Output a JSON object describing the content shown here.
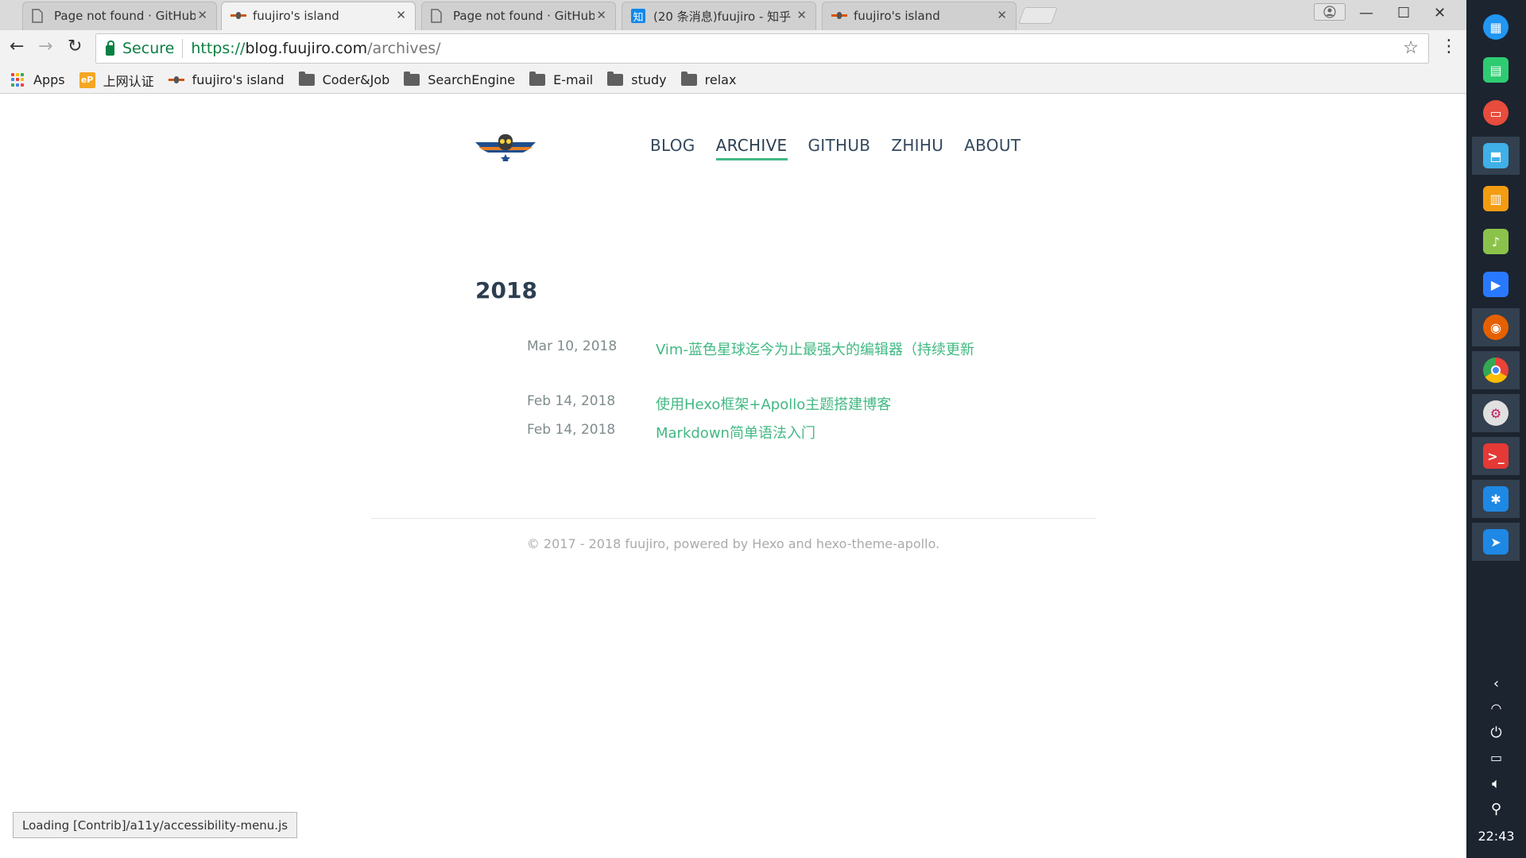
{
  "browser": {
    "tabs": [
      {
        "title": "Page not found · GitHub",
        "icon": "page-icon",
        "active": false
      },
      {
        "title": "fuujiro's island",
        "icon": "plane-icon",
        "active": true
      },
      {
        "title": "Page not found · GitHub",
        "icon": "page-icon",
        "active": false
      },
      {
        "title": "(20 条消息)fuujiro - 知乎",
        "icon": "zhihu-icon",
        "active": false
      },
      {
        "title": "fuujiro's island",
        "icon": "plane-icon",
        "active": false
      }
    ],
    "zhihu_glyph": "知",
    "secure_label": "Secure",
    "url_scheme": "https://",
    "url_host": "blog.fuujiro.com",
    "url_path": "/archives/",
    "bookmarks": [
      {
        "label": "Apps",
        "icon": "apps-grid-icon"
      },
      {
        "label": "上网认证",
        "icon": "ep-icon"
      },
      {
        "label": "fuujiro's island",
        "icon": "plane-icon"
      },
      {
        "label": "Coder&Job",
        "icon": "folder-icon"
      },
      {
        "label": "SearchEngine",
        "icon": "folder-icon"
      },
      {
        "label": "E-mail",
        "icon": "folder-icon"
      },
      {
        "label": "study",
        "icon": "folder-icon"
      },
      {
        "label": "relax",
        "icon": "folder-icon"
      }
    ],
    "ep_glyph": "eP",
    "status": "Loading [Contrib]/a11y/accessibility-menu.js"
  },
  "site": {
    "nav": [
      {
        "label": "BLOG",
        "active": false
      },
      {
        "label": "ARCHIVE",
        "active": true
      },
      {
        "label": "GITHUB",
        "active": false
      },
      {
        "label": "ZHIHU",
        "active": false
      },
      {
        "label": "ABOUT",
        "active": false
      }
    ],
    "year": "2018",
    "posts": [
      {
        "date": "Mar 10, 2018",
        "title": "Vim-蓝色星球迄今为止最强大的编辑器（持续更新"
      },
      {
        "date": "Feb 14, 2018",
        "title": "使用Hexo框架+Apollo主题搭建博客"
      },
      {
        "date": "Feb 14, 2018",
        "title": "Markdown简单语法入门"
      }
    ],
    "footer": "© 2017 - 2018 fuujiro, powered by Hexo and hexo-theme-apollo.",
    "accent_color": "#42b983"
  },
  "dock": {
    "apps": [
      {
        "name": "launcher-icon",
        "color": "#2196f3"
      },
      {
        "name": "file-manager-icon",
        "color": "#2ecc71"
      },
      {
        "name": "screen-recorder-icon",
        "color": "#e74c3c"
      },
      {
        "name": "app-store-icon",
        "color": "#3fb0e8"
      },
      {
        "name": "store-bag-icon",
        "color": "#f39c12"
      },
      {
        "name": "music-icon",
        "color": "#8bc34a"
      },
      {
        "name": "video-icon",
        "color": "#2979ff"
      },
      {
        "name": "firefox-icon",
        "color": "#e66000"
      },
      {
        "name": "chrome-icon",
        "color": "#4285f4"
      },
      {
        "name": "settings-icon",
        "color": "#e0e0e0"
      },
      {
        "name": "terminal-icon",
        "color": "#e53935"
      },
      {
        "name": "star-app-icon",
        "color": "#1e88e5"
      },
      {
        "name": "paper-plane-icon",
        "color": "#1e88e5"
      }
    ],
    "time": "22:43"
  }
}
